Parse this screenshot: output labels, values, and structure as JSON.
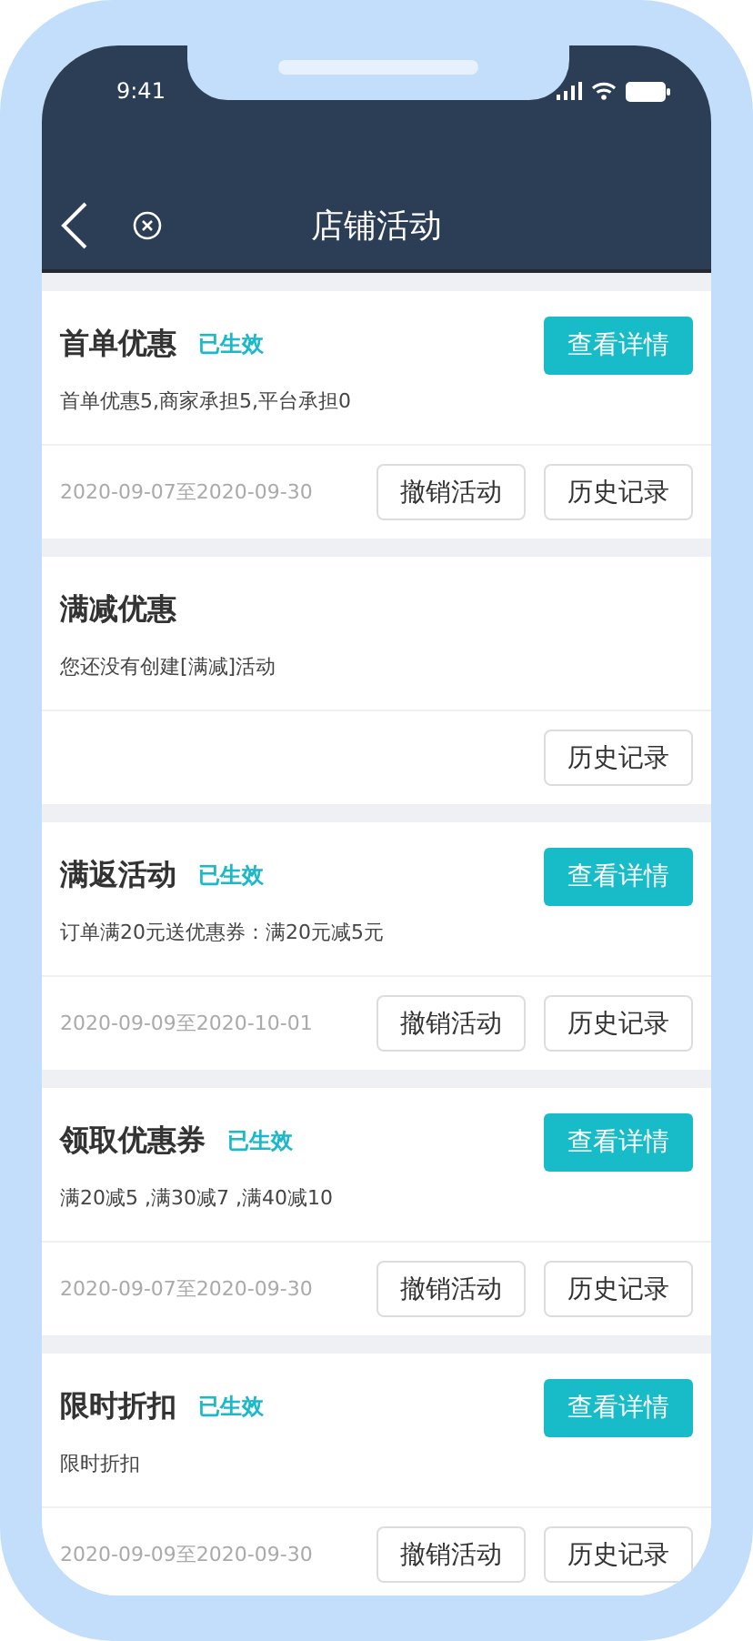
{
  "status_bar": {
    "time": "9:41"
  },
  "nav": {
    "title": "店铺活动"
  },
  "cards": [
    {
      "title": "首单优惠",
      "status": "已生效",
      "detail_button": "查看详情",
      "description": "首单优惠5,商家承担5,平台承担0",
      "date_range": "2020-09-07至2020-09-30",
      "actions": [
        "撤销活动",
        "历史记录"
      ]
    },
    {
      "title": "满减优惠",
      "description": "您还没有创建[满减]活动",
      "actions": [
        "历史记录"
      ]
    },
    {
      "title": "满返活动",
      "status": "已生效",
      "detail_button": "查看详情",
      "description": "订单满20元送优惠券：满20元减5元",
      "date_range": "2020-09-09至2020-10-01",
      "actions": [
        "撤销活动",
        "历史记录"
      ]
    },
    {
      "title": "领取优惠券",
      "status": "已生效",
      "detail_button": "查看详情",
      "description": "满20减5 ,满30减7 ,满40减10",
      "date_range": "2020-09-07至2020-09-30",
      "actions": [
        "撤销活动",
        "历史记录"
      ]
    },
    {
      "title": "限时折扣",
      "status": "已生效",
      "detail_button": "查看详情",
      "description": "限时折扣",
      "date_range": "2020-09-09至2020-09-30",
      "actions": [
        "撤销活动",
        "历史记录"
      ]
    }
  ]
}
